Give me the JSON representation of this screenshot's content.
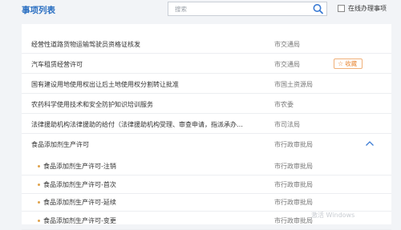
{
  "header": {
    "title": "事项列表",
    "search_placeholder": "搜索",
    "online_filter_label": "在线办理事项"
  },
  "items": [
    {
      "name": "经营性道路货物运输驾驶员资格证核发",
      "dept": "市交通局"
    },
    {
      "name": "汽车租赁经营许可",
      "dept": "市交通局",
      "favorite_label": "收藏"
    },
    {
      "name": "国有建设用地使用权出让后土地使用权分割转让批准",
      "dept": "市国土资源局"
    },
    {
      "name": "农药科学使用技术和安全防护知识培训服务",
      "dept": "市农委"
    },
    {
      "name": "法律援助机构法律援助的给付（法律援助机构受理、审查申请，指派承办…",
      "dept": "市司法局"
    },
    {
      "name": "食品添加剂生产许可",
      "dept": "市行政审批局",
      "expanded": true,
      "children": [
        {
          "name": "食品添加剂生产许可-注销",
          "dept": "市行政审批局"
        },
        {
          "name": "食品添加剂生产许可-首次",
          "dept": "市行政审批局"
        },
        {
          "name": "食品添加剂生产许可-延续",
          "dept": "市行政审批局"
        },
        {
          "name": "食品添加剂生产许可-变更",
          "dept": "市行政审批局"
        }
      ]
    }
  ],
  "watermark": "激活 Windows",
  "colors": {
    "accent": "#2a6fc2",
    "favorite": "#e88a3a",
    "bullet": "#e0a24a"
  }
}
